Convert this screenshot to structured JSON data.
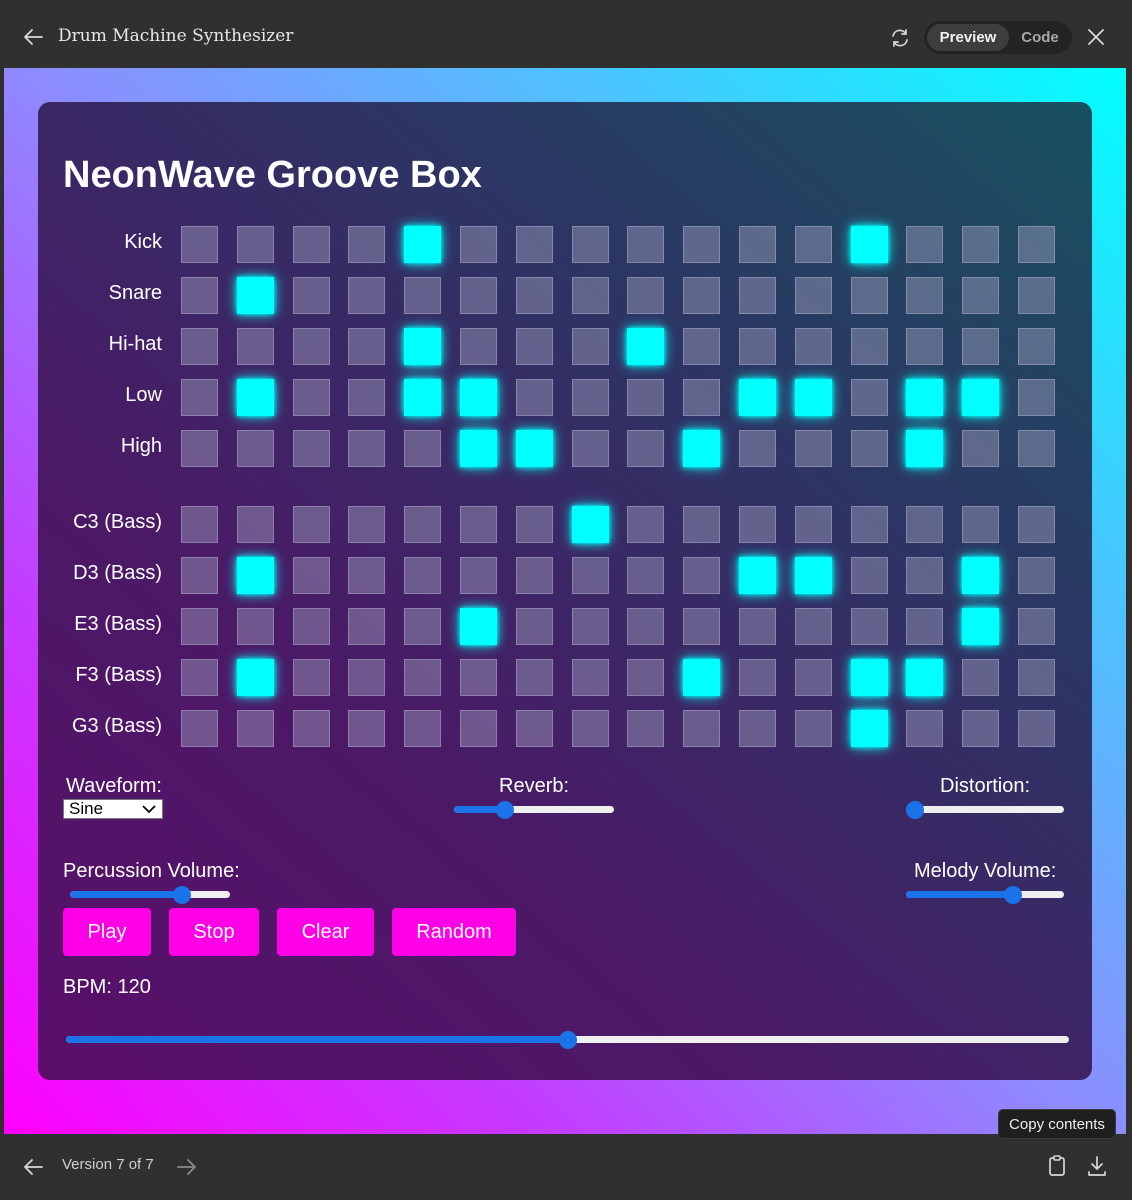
{
  "window": {
    "title": "Drum Machine Synthesizer",
    "preview_label": "Preview",
    "code_label": "Code",
    "icons": {
      "back": "arrow-left-icon",
      "refresh": "refresh-icon",
      "close": "close-icon"
    }
  },
  "app": {
    "title": "NeonWave Groove Box",
    "accent": "#00ffff",
    "button_color": "#ff00e6",
    "slider_color": "#1a73e8",
    "steps": 16,
    "tracks": [
      {
        "label": "Kick",
        "active": [
          4,
          12
        ]
      },
      {
        "label": "Snare",
        "active": [
          1
        ]
      },
      {
        "label": "Hi-hat",
        "active": [
          4,
          8
        ]
      },
      {
        "label": "Low",
        "active": [
          1,
          4,
          5,
          10,
          11,
          13,
          14
        ]
      },
      {
        "label": "High",
        "active": [
          5,
          6,
          9,
          13
        ]
      },
      {
        "label": "C3 (Bass)",
        "active": [
          7
        ]
      },
      {
        "label": "D3 (Bass)",
        "active": [
          1,
          10,
          11,
          14
        ]
      },
      {
        "label": "E3 (Bass)",
        "active": [
          5,
          14
        ]
      },
      {
        "label": "F3 (Bass)",
        "active": [
          1,
          9,
          12,
          13
        ]
      },
      {
        "label": "G3 (Bass)",
        "active": [
          12
        ]
      }
    ],
    "controls": {
      "waveform_label": "Waveform:",
      "waveform_value": "Sine",
      "reverb_label": "Reverb:",
      "reverb_value": 0.32,
      "distortion_label": "Distortion:",
      "distortion_value": 0.0,
      "percussion_label": "Percussion Volume:",
      "percussion_value": 0.7,
      "melody_label": "Melody Volume:",
      "melody_value": 0.68,
      "bpm_label": "BPM: 120",
      "bpm_value": 0.5
    },
    "buttons": {
      "play": "Play",
      "stop": "Stop",
      "clear": "Clear",
      "random": "Random"
    }
  },
  "footer": {
    "version_text": "Version 7 of 7",
    "tooltip": "Copy contents",
    "icons": {
      "prev": "arrow-left-icon",
      "next": "arrow-right-icon",
      "clipboard": "clipboard-icon",
      "download": "download-icon"
    }
  }
}
